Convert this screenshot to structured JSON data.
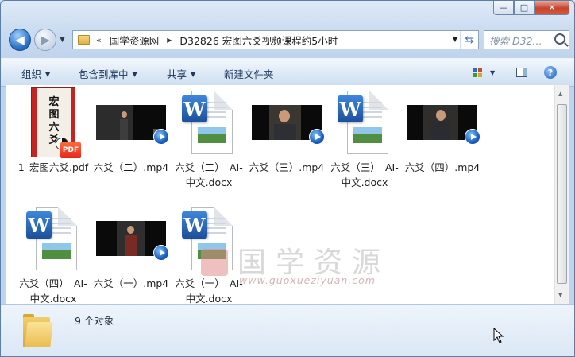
{
  "window": {
    "min_label": "—",
    "max_label": "□",
    "close_label": "✕"
  },
  "nav": {
    "back_glyph": "◀",
    "forward_glyph": "▶",
    "address": {
      "overflow": "«",
      "crumbs": [
        "国学资源网",
        "D32826 宏图六爻视频课程约5小时"
      ]
    },
    "search_placeholder": "搜索 D32..."
  },
  "toolbar": {
    "organize": "组织",
    "include_library": "包含到库中",
    "share": "共享",
    "new_folder": "新建文件夹"
  },
  "files": [
    {
      "name_line1": "1_宏图六爻.pdf",
      "name_line2": "",
      "type": "pdf"
    },
    {
      "name_line1": "六爻（二）.mp4",
      "name_line2": "",
      "type": "video"
    },
    {
      "name_line1": "六爻（二）_AI-",
      "name_line2": "中文.docx",
      "type": "docx"
    },
    {
      "name_line1": "六爻（三）.mp4",
      "name_line2": "",
      "type": "video"
    },
    {
      "name_line1": "六爻（三）_AI-",
      "name_line2": "中文.docx",
      "type": "docx"
    },
    {
      "name_line1": "六爻（四）.mp4",
      "name_line2": "",
      "type": "video"
    },
    {
      "name_line1": "六爻（四）_AI-",
      "name_line2": "中文.docx",
      "type": "docx"
    },
    {
      "name_line1": "六爻（一）.mp4",
      "name_line2": "",
      "type": "video"
    },
    {
      "name_line1": "六爻（一）_AI-",
      "name_line2": "中文.docx",
      "type": "docx"
    }
  ],
  "pdf_cover": {
    "chars": [
      "宏",
      "图",
      "六",
      "爻"
    ],
    "badge": "PDF"
  },
  "docx_letter": "W",
  "watermark": {
    "text": "国学资源",
    "url": "www.guoxueziyuan.com"
  },
  "details": {
    "count": "9 个对象"
  },
  "icons": [
    "back-icon",
    "forward-icon",
    "folder-icon",
    "refresh-icon",
    "search-icon",
    "view-icon",
    "preview-pane-icon",
    "help-icon"
  ]
}
